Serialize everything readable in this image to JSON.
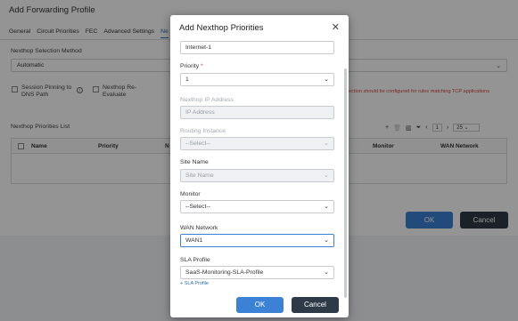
{
  "background": {
    "title": "Add Forwarding Profile",
    "tabs": [
      "General",
      "Circuit Priorities",
      "FEC",
      "Advanced Settings",
      "Ne"
    ],
    "nexthop_method_label": "Nexthop Selection Method",
    "nexthop_method_value": "Automatic",
    "session_pinning_line1": "Session Pinning to",
    "session_pinning_line2": "DNS Path",
    "nexthop_reeval_line1": "Nexthop Re-",
    "nexthop_reeval_line2": "Evaluate",
    "warning_text": "ection should be configured for rules matching TCP applications",
    "table_title": "Nexthop Priorities List",
    "columns": [
      "Name",
      "Priority",
      "N",
      "Monitor",
      "WAN Network"
    ],
    "page_number": "1",
    "page_size": "25",
    "ok_label": "OK",
    "cancel_label": "Cancel"
  },
  "modal": {
    "title": "Add Nexthop Priorities",
    "name_value": "Internet-1",
    "priority_label": "Priority",
    "priority_required": "*",
    "priority_value": "1",
    "nexthop_ip_label": "Nexthop IP Address",
    "nexthop_ip_placeholder": "IP Address",
    "routing_instance_label": "Routing Instance",
    "routing_instance_value": "--Select--",
    "site_name_label": "Site Name",
    "site_name_placeholder": "Site Name",
    "monitor_label": "Monitor",
    "monitor_value": "--Select--",
    "wan_network_label": "WAN Network",
    "wan_network_value": "WAN1",
    "sla_profile_label": "SLA Profile",
    "sla_profile_value": "SaaS-Monitoring-SLA-Profile",
    "add_sla_link": "+ SLA Profile",
    "ok_label": "OK",
    "cancel_label": "Cancel"
  },
  "colors": {
    "primary": "#3b82d6",
    "dark": "#2f3a48",
    "required": "#d0463b"
  }
}
